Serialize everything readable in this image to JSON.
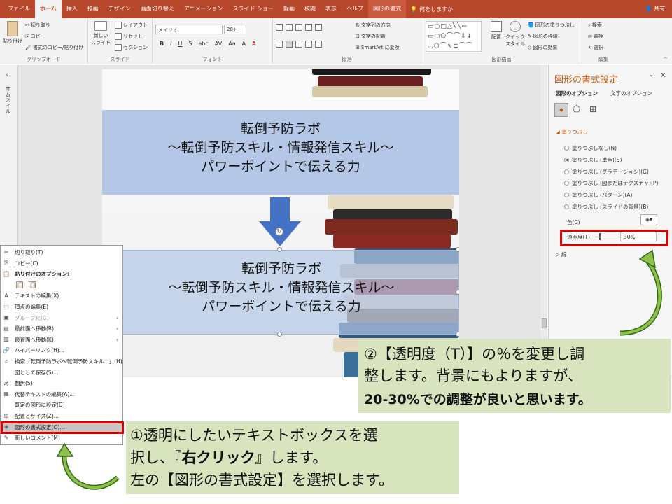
{
  "tabs": [
    "ファイル",
    "ホーム",
    "挿入",
    "描画",
    "デザイン",
    "画面切り替え",
    "アニメーション",
    "スライド ショー",
    "録画",
    "校閲",
    "表示",
    "ヘルプ",
    "図形の書式"
  ],
  "tell_me": "何をしますか",
  "share": "共有",
  "ribbon": {
    "clipboard": {
      "paste": "貼り付け",
      "cut": "切り取り",
      "copy": "コピー",
      "format_painter": "書式のコピー/貼り付け",
      "label": "クリップボード"
    },
    "slides": {
      "new_slide": "新しい\nスライド",
      "layout": "レイアウト",
      "reset": "リセット",
      "section": "セクション",
      "label": "スライド"
    },
    "font": {
      "name": "メイリオ",
      "size": "28+",
      "label": "フォント",
      "buttons": [
        "B",
        "I",
        "U",
        "S",
        "abc",
        "AV",
        "Aa",
        "A",
        "A"
      ]
    },
    "paragraph": {
      "direction": "文字列の方向",
      "align": "文字の配置",
      "smartart": "SmartArt に変換",
      "label": "段落"
    },
    "drawing": {
      "arrange": "配置",
      "quick_style": "クイック\nスタイル",
      "fill": "図形の塗りつぶし",
      "outline": "図形の枠線",
      "effects": "図形の効果",
      "label": "図形描画"
    },
    "editing": {
      "find": "検索",
      "replace": "置換",
      "select": "選択",
      "label": "編集"
    }
  },
  "thumb_pane_label": "サムネイル",
  "slide": {
    "top_band": [
      "転倒予防ラボ",
      "～転倒予防スキル・情報発信スキル～",
      "パワーポイントで伝える力"
    ],
    "bottom_band": [
      "転倒予防ラボ",
      "～転倒予防スキル・情報発信スキル～",
      "パワーポイントで伝える力"
    ]
  },
  "format_pane": {
    "title": "図形の書式設定",
    "tab_shape": "図形のオプション",
    "tab_text": "文字のオプション",
    "section_fill": "塗りつぶし",
    "fill_options": [
      "塗りつぶしなし(N)",
      "塗りつぶし (単色)(S)",
      "塗りつぶし (グラデーション)(G)",
      "塗りつぶし (図またはテクスチャ)(P)",
      "塗りつぶし (パターン)(A)",
      "塗りつぶし (スライドの背景)(B)"
    ],
    "selected_fill": 1,
    "color_label": "色(C)",
    "transparency_label": "透明度(T)",
    "transparency_value": "30%",
    "section_line": "線"
  },
  "context_menu": [
    {
      "label": "切り取り(T)",
      "icon": "scissors-icon",
      "glyph": "✂",
      "dis": false,
      "arrow": false
    },
    {
      "label": "コピー(C)",
      "icon": "copy-icon",
      "glyph": "⎘",
      "dis": false,
      "arrow": false
    },
    {
      "label": "貼り付けのオプション:",
      "icon": "paste-icon",
      "glyph": "📋",
      "dis": false,
      "arrow": false,
      "bold": true
    },
    {
      "label": "",
      "icon": "paste-options-icon",
      "glyph": "",
      "dis": false,
      "arrow": false
    },
    {
      "label": "テキストの編集(X)",
      "icon": "text-edit-icon",
      "glyph": "A",
      "dis": false,
      "arrow": false
    },
    {
      "label": "頂点の編集(E)",
      "icon": "edit-points-icon",
      "glyph": "⬚",
      "dis": false,
      "arrow": false
    },
    {
      "label": "グループ化(G)",
      "icon": "group-icon",
      "glyph": "▣",
      "dis": true,
      "arrow": true
    },
    {
      "label": "最前面へ移動(R)",
      "icon": "bring-front-icon",
      "glyph": "▤",
      "dis": false,
      "arrow": true
    },
    {
      "label": "最背面へ移動(K)",
      "icon": "send-back-icon",
      "glyph": "▥",
      "dis": false,
      "arrow": true
    },
    {
      "label": "ハイパーリンク(H)...",
      "icon": "link-icon",
      "glyph": "🔗",
      "dis": false,
      "arrow": false
    },
    {
      "label": "検索「転倒予防ラボ～転倒予防スキル...」(H)",
      "icon": "search-icon",
      "glyph": "⌕",
      "dis": false,
      "arrow": false
    },
    {
      "label": "図として保存(S)...",
      "icon": "save-picture-icon",
      "glyph": "",
      "dis": false,
      "arrow": false
    },
    {
      "label": "翻訳(S)",
      "icon": "translate-icon",
      "glyph": "あ",
      "dis": false,
      "arrow": false
    },
    {
      "label": "代替テキストの編集(A)...",
      "icon": "alt-text-icon",
      "glyph": "▦",
      "dis": false,
      "arrow": false
    },
    {
      "label": "既定の図形に設定(D)",
      "icon": "default-shape-icon",
      "glyph": "",
      "dis": false,
      "arrow": false
    },
    {
      "label": "配置とサイズ(Z)...",
      "icon": "size-position-icon",
      "glyph": "⊞",
      "dis": false,
      "arrow": false
    },
    {
      "label": "図形の書式設定(O)...",
      "icon": "format-shape-icon",
      "glyph": "◈",
      "dis": false,
      "arrow": false,
      "highlight": true
    },
    {
      "label": "新しいコメント(M)",
      "icon": "comment-icon",
      "glyph": "✎",
      "dis": false,
      "arrow": false
    }
  ],
  "callout1": {
    "l1": "①透明にしたいテキストボックスを選",
    "l2a": "択し、『",
    "l2b": "右クリック",
    "l2c": "』します。",
    "l3": "左の【図形の書式設定】を選択します。"
  },
  "callout2": {
    "l1": "②【透明度（T）】の％を変更し調",
    "l2": "整します。背景にもよりますが、",
    "l3": "20-30%での調整が良いと思います。"
  },
  "colors": {
    "accent": "#b7472a",
    "band": "#b4c7e7",
    "callout": "#d7e4bd",
    "highlight": "#e00000",
    "arrow_green": "#5a8a2a"
  }
}
